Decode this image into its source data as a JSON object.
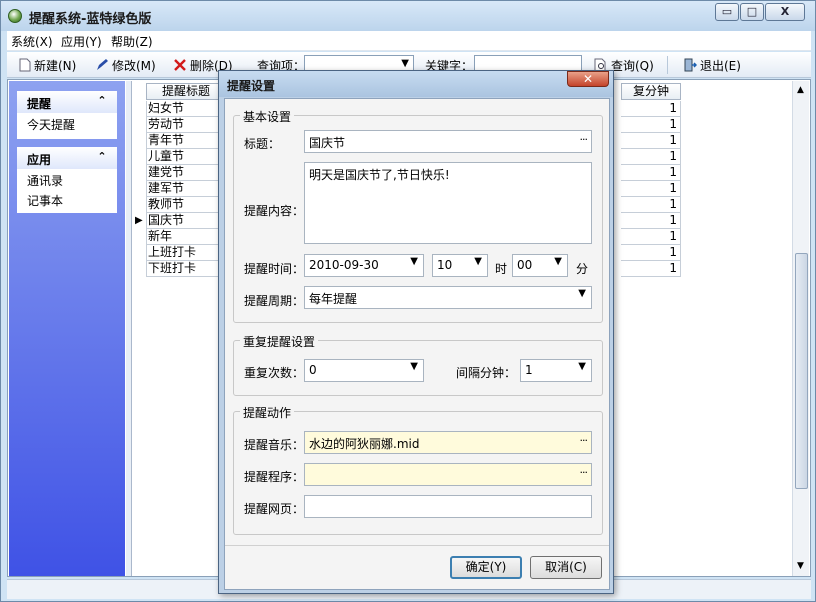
{
  "window": {
    "title": "提醒系统-蓝特绿色版",
    "min": "▭",
    "max": "□",
    "close": "X"
  },
  "menu": [
    "系统(X)",
    "应用(Y)",
    "帮助(Z)"
  ],
  "toolbar": {
    "new": "新建(N)",
    "edit": "修改(M)",
    "delete": "删除(D)",
    "query_label": "查询项：",
    "keyword_label": "关键字：",
    "search": "查询(Q)",
    "exit": "退出(E)"
  },
  "sidebar": {
    "group1": {
      "title": "提醒",
      "items": [
        "今天提醒"
      ]
    },
    "group2": {
      "title": "应用",
      "items": [
        "通讯录",
        "记事本"
      ]
    }
  },
  "grid": {
    "col_title": "提醒标题",
    "col_repeat": "复分钟",
    "rows": [
      {
        "title": "妇女节",
        "minutes": "1"
      },
      {
        "title": "劳动节",
        "minutes": "1"
      },
      {
        "title": "青年节",
        "minutes": "1"
      },
      {
        "title": "儿童节",
        "minutes": "1"
      },
      {
        "title": "建党节",
        "minutes": "1"
      },
      {
        "title": "建军节",
        "minutes": "1"
      },
      {
        "title": "教师节",
        "minutes": "1"
      },
      {
        "title": "国庆节",
        "minutes": "1",
        "selected": true
      },
      {
        "title": "新年",
        "minutes": "1"
      },
      {
        "title": "上班打卡",
        "minutes": "1"
      },
      {
        "title": "下班打卡",
        "minutes": "1"
      }
    ]
  },
  "dialog": {
    "title": "提醒设置",
    "basic": {
      "group": "基本设置",
      "title_label": "标题：",
      "title_value": "国庆节",
      "content_label": "提醒内容：",
      "content_value": "明天是国庆节了,节日快乐!",
      "time_label": "提醒时间：",
      "date": "2010-09-30",
      "hour": "10",
      "hour_unit": "时",
      "minute": "00",
      "minute_unit": "分",
      "period_label": "提醒周期：",
      "period": "每年提醒"
    },
    "repeat": {
      "group": "重复提醒设置",
      "count_label": "重复次数：",
      "count": "0",
      "interval_label": "间隔分钟：",
      "interval": "1"
    },
    "action": {
      "group": "提醒动作",
      "music_label": "提醒音乐：",
      "music": "水边的阿狄丽娜.mid",
      "program_label": "提醒程序：",
      "program": "",
      "web_label": "提醒网页：",
      "web": ""
    },
    "ok": "确定(Y)",
    "cancel": "取消(C)"
  }
}
